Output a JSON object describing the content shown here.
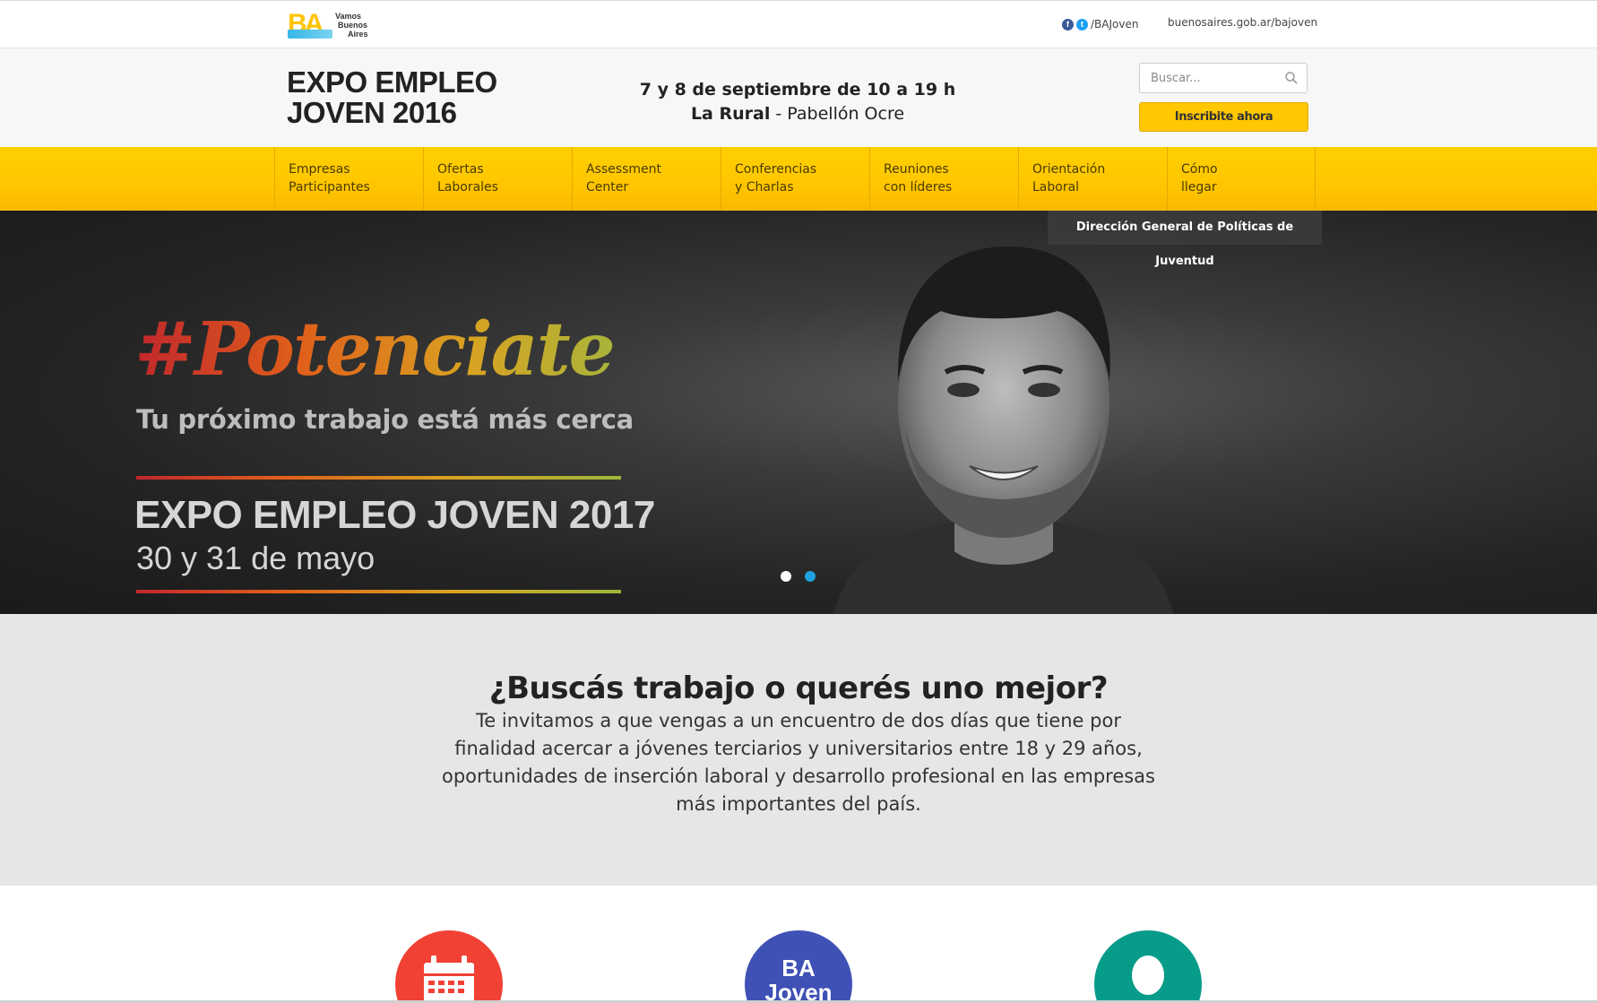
{
  "topbar": {
    "logo_words": [
      "Vamos",
      "Buenos",
      "Aires"
    ],
    "social_handle": "/BAJoven",
    "site_link": "buenosaires.gob.ar/bajoven"
  },
  "header": {
    "title_line1": "EXPO EMPLEO",
    "title_line2": "JOVEN 2016",
    "date": "7 y 8 de septiembre de 10 a 19 h",
    "place_bold": "La Rural",
    "place_rest": " - Pabellón Ocre",
    "search_placeholder": "Buscar...",
    "register_label": "Inscribite ahora"
  },
  "nav": {
    "items": [
      {
        "line1": "Empresas",
        "line2": "Participantes"
      },
      {
        "line1": "Ofertas",
        "line2": "Laborales"
      },
      {
        "line1": "Assessment",
        "line2": "Center"
      },
      {
        "line1": "Conferencias",
        "line2": "y Charlas"
      },
      {
        "line1": "Reuniones",
        "line2": "con líderes"
      },
      {
        "line1": "Orientación",
        "line2": "Laboral"
      },
      {
        "line1": "Cómo",
        "line2": "llegar"
      }
    ]
  },
  "hero": {
    "tag": "Dirección General de Políticas de Juventud",
    "hashtag": "#Potenciate",
    "subtitle": "Tu próximo trabajo está más cerca",
    "expo": "EXPO EMPLEO JOVEN 2017",
    "dates": "30 y 31 de mayo",
    "slides_total": 2,
    "active_slide": 2
  },
  "intro": {
    "title": "¿Buscás trabajo o querés uno mejor?",
    "text": "Te invitamos a que vengas a un encuentro de dos días que tiene por finalidad acercar a jóvenes terciarios y universitarios entre 18 y 29 años, oportunidades de inserción laboral y desarrollo profesional en las empresas más importantes del país."
  },
  "features": {
    "ba_line1": "BA",
    "ba_line2": "Joven",
    "icons": [
      "calendar-icon",
      "ba-joven-icon",
      "person-icon"
    ]
  },
  "colors": {
    "brand_yellow": "#ffc800",
    "calendar_red": "#f14135",
    "ba_blue": "#3f51b5",
    "person_teal": "#079b8a",
    "slider_active": "#1fa3e0"
  }
}
